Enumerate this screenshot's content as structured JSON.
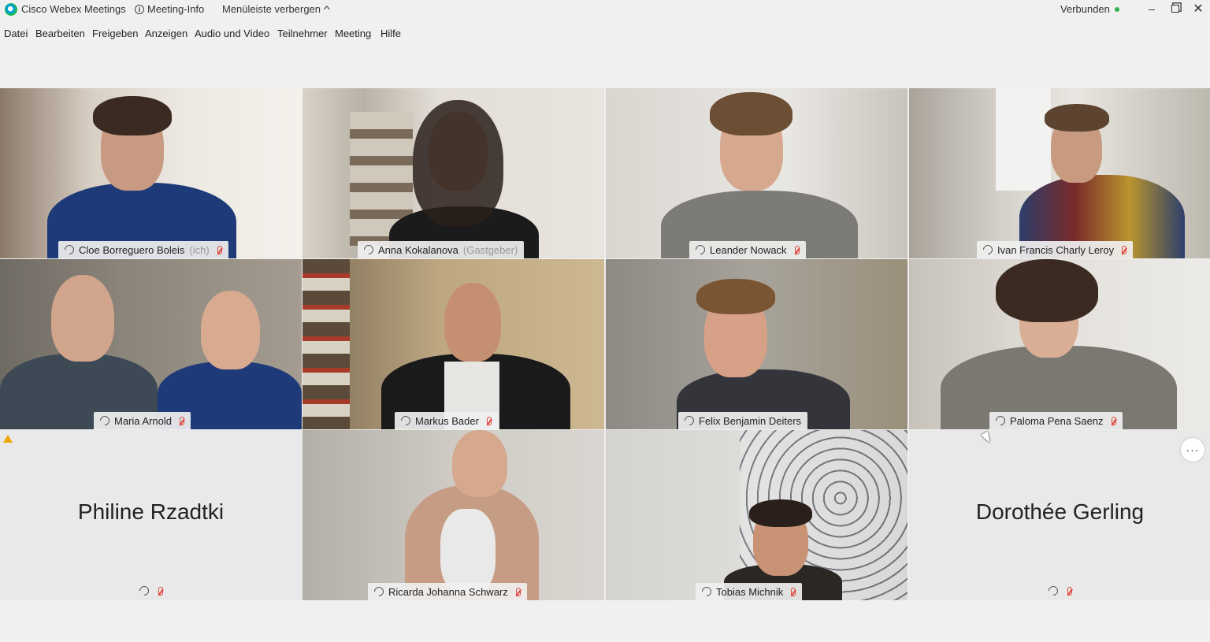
{
  "titlebar": {
    "app_title": "Cisco Webex Meetings",
    "meeting_info": "Meeting-Info",
    "hide_menu": "Menüleiste verbergen",
    "status": "Verbunden"
  },
  "menu": [
    "Datei",
    "Bearbeiten",
    "Freigeben",
    "Anzeigen",
    "Audio und Video",
    "Teilnehmer",
    "Meeting",
    "Hilfe"
  ],
  "participants": [
    {
      "name": "Cloe Borreguero Boleis",
      "role": "(ich)",
      "video": true
    },
    {
      "name": "Anna Kokalanova",
      "role": "(Gastgeber)",
      "video": true,
      "active": true
    },
    {
      "name": "Leander Nowack",
      "role": "",
      "video": true
    },
    {
      "name": "Ivan Francis Charly Leroy",
      "role": "",
      "video": true
    },
    {
      "name": "Maria Arnold",
      "role": "",
      "video": true
    },
    {
      "name": "Markus Bader",
      "role": "",
      "video": true
    },
    {
      "name": "Felix Benjamin Deiters",
      "role": "",
      "video": true
    },
    {
      "name": "Paloma Pena Saenz",
      "role": "",
      "video": true
    },
    {
      "name": "Philine Rzadtki",
      "role": "",
      "video": false
    },
    {
      "name": "Ricarda Johanna Schwarz",
      "role": "",
      "video": true
    },
    {
      "name": "Tobias Michnik",
      "role": "",
      "video": true
    },
    {
      "name": "Dorothée Gerling",
      "role": "",
      "video": false
    }
  ],
  "colors": {
    "active_border": "#2fb6e9",
    "muted_mic": "#e0453c",
    "connected": "#2fb34a"
  },
  "icons": {
    "more_button": "···"
  }
}
